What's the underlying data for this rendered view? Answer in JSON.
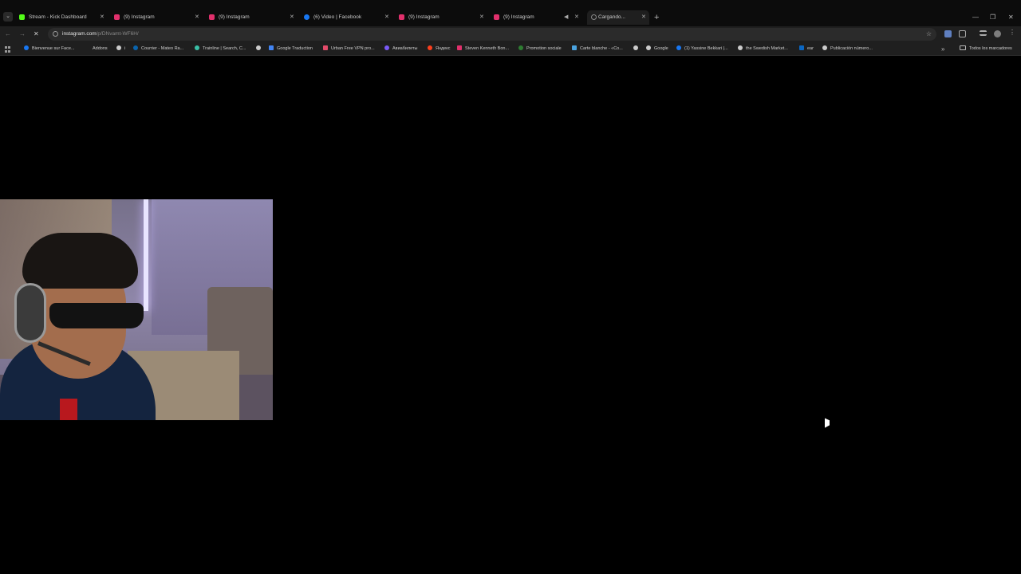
{
  "tabs": [
    {
      "title": "Stream - Kick Dashboard",
      "favicon": "kick-icon",
      "color": "#53fc18"
    },
    {
      "title": "(9) Instagram",
      "favicon": "instagram-icon",
      "color": "#e1306c"
    },
    {
      "title": "(9) Instagram",
      "favicon": "instagram-icon",
      "color": "#e1306c"
    },
    {
      "title": "(6) Video | Facebook",
      "favicon": "facebook-icon",
      "color": "#1877f2"
    },
    {
      "title": "(9) Instagram",
      "favicon": "instagram-icon",
      "color": "#e1306c"
    },
    {
      "title": "(9) Instagram",
      "favicon": "instagram-icon",
      "color": "#e1306c"
    },
    {
      "title": "Cargando...",
      "favicon": "loading-icon",
      "color": "#888888"
    }
  ],
  "address_bar": {
    "domain": "instagram.com",
    "path": "/p/DNvamt-WF6H/"
  },
  "bookmarks": [
    {
      "label": "Bienvenue sur Face...",
      "icon": "facebook-icon",
      "color": "#1877f2"
    },
    {
      "label": "Addons",
      "icon": "",
      "color": ""
    },
    {
      "label": "i",
      "icon": "globe-icon",
      "color": "#cccccc"
    },
    {
      "label": "Courrier - Mateo Ra...",
      "icon": "outlook-icon",
      "color": "#0a64ad"
    },
    {
      "label": "Trainline | Search, C...",
      "icon": "trainline-icon",
      "color": "#3ac0a7"
    },
    {
      "label": "",
      "icon": "globe-icon",
      "color": "#cccccc"
    },
    {
      "label": "Google Traduction",
      "icon": "translate-icon",
      "color": "#4285f4"
    },
    {
      "label": "Urban Free VPN pro...",
      "icon": "vpn-icon",
      "color": "#e34b6a"
    },
    {
      "label": "Авиабилеты",
      "icon": "plane-icon",
      "color": "#7a5af8"
    },
    {
      "label": "Яндекс",
      "icon": "yandex-icon",
      "color": "#fc3f1d"
    },
    {
      "label": "Steven Kenneth Bon...",
      "icon": "instagram-icon",
      "color": "#e1306c"
    },
    {
      "label": "Promotion sociale",
      "icon": "leaf-icon",
      "color": "#2e7d32"
    },
    {
      "label": "Carte blanche - «Co...",
      "icon": "s-icon",
      "color": "#4aa3df"
    },
    {
      "label": "",
      "icon": "globe-icon",
      "color": "#cccccc"
    },
    {
      "label": "Google",
      "icon": "globe-icon",
      "color": "#cccccc"
    },
    {
      "label": "(1) Yassine Bekkari |...",
      "icon": "facebook-icon",
      "color": "#1877f2"
    },
    {
      "label": "the Swedish Market...",
      "icon": "globe-icon",
      "color": "#cccccc"
    },
    {
      "label": "ear",
      "icon": "linkedin-icon",
      "color": "#0a66c2"
    },
    {
      "label": "Publicación número...",
      "icon": "globe-icon",
      "color": "#cccccc"
    }
  ],
  "all_bookmarks_label": "Todos los marcadores",
  "webcam_overlay": "streamer-webcam"
}
